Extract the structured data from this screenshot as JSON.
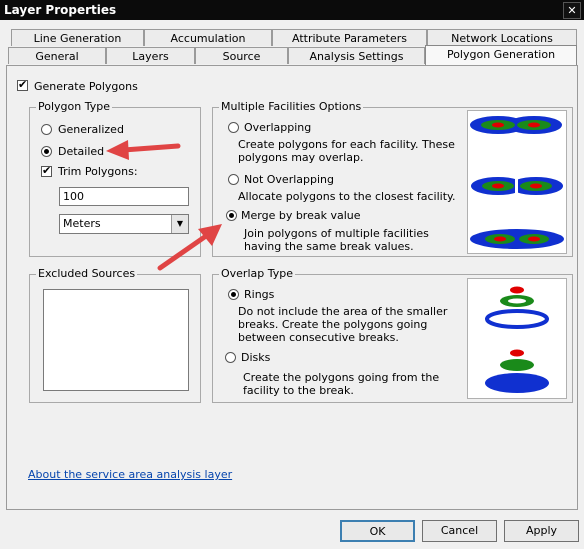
{
  "window": {
    "title": "Layer Properties",
    "close": "✕"
  },
  "tabs_row1": [
    "Line Generation",
    "Accumulation",
    "Attribute Parameters",
    "Network Locations"
  ],
  "tabs_row2": [
    "General",
    "Layers",
    "Source",
    "Analysis Settings",
    "Polygon Generation"
  ],
  "generate_polygons": {
    "label": "Generate Polygons",
    "checked": true
  },
  "polygon_type": {
    "title": "Polygon Type",
    "generalized": "Generalized",
    "detailed": "Detailed",
    "trim_label": "Trim Polygons:",
    "trim_value": "100",
    "unit": "Meters"
  },
  "excluded_sources": {
    "title": "Excluded Sources"
  },
  "multiple_facilities": {
    "title": "Multiple Facilities Options",
    "overlapping": "Overlapping",
    "overlapping_desc": "Create polygons for each facility. These polygons may overlap.",
    "not_overlapping": "Not Overlapping",
    "not_overlapping_desc": "Allocate polygons to the closest facility.",
    "merge": "Merge by break value",
    "merge_desc": "Join polygons of multiple facilities having the same break values."
  },
  "overlap_type": {
    "title": "Overlap Type",
    "rings": "Rings",
    "rings_desc": "Do not include the area of the smaller breaks. Create the polygons going between consecutive breaks.",
    "disks": "Disks",
    "disks_desc": "Create the polygons going from the facility to the break."
  },
  "link": "About the service area analysis layer",
  "buttons": {
    "ok": "OK",
    "cancel": "Cancel",
    "apply": "Apply"
  },
  "colors": {
    "ring_outer": "#1030d0",
    "ring_mid": "#1a8a1a",
    "ring_inner": "#e00000",
    "arrow": "#e04444"
  }
}
